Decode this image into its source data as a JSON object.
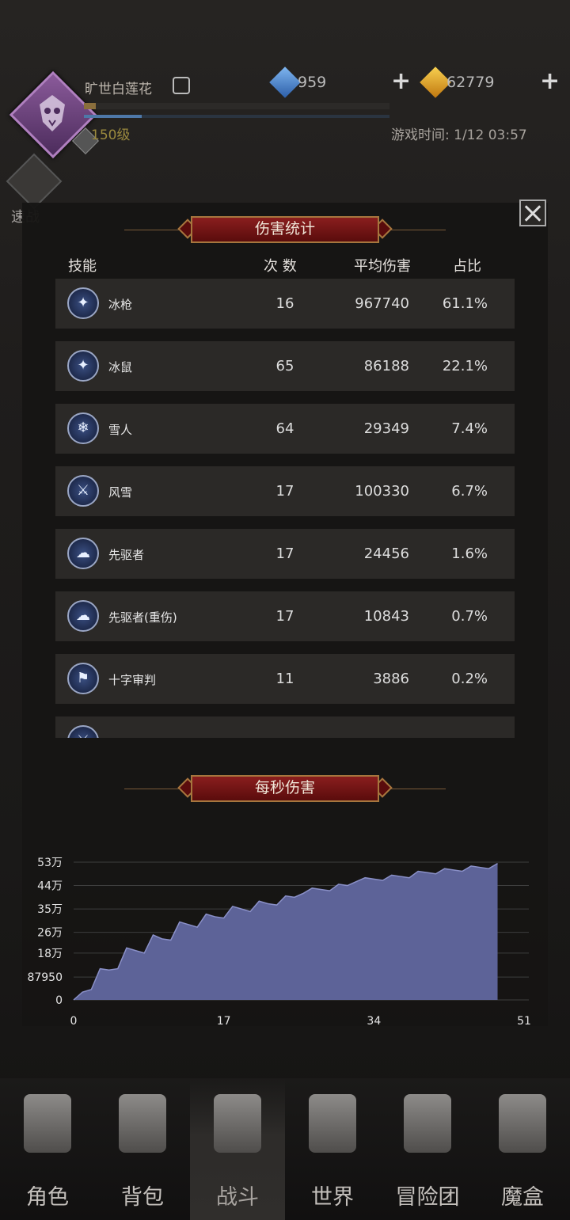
{
  "header": {
    "player_name": "旷世白莲花",
    "level": "150级",
    "exp_fraction": 0.04,
    "energy_fraction": 0.19,
    "currency_gems": "959",
    "currency_gold": "62779",
    "game_time": "游戏时间: 1/12 03:57",
    "quick_battle": "速战"
  },
  "modal": {
    "title": "伤害统计",
    "columns": {
      "skill": "技能",
      "count": "次 数",
      "avg": "平均伤害",
      "ratio": "占比"
    },
    "rows": [
      {
        "icon": "ice-spear-icon",
        "glyph": "✦",
        "name": "冰枪",
        "count": "16",
        "avg": "967740",
        "pct": "61.1%"
      },
      {
        "icon": "ice-rat-icon",
        "glyph": "✦",
        "name": "冰鼠",
        "count": "65",
        "avg": "86188",
        "pct": "22.1%"
      },
      {
        "icon": "snowflake-icon",
        "glyph": "❄",
        "name": "雪人",
        "count": "64",
        "avg": "29349",
        "pct": "7.4%"
      },
      {
        "icon": "sword-icon",
        "glyph": "⚔",
        "name": "风雪",
        "count": "17",
        "avg": "100330",
        "pct": "6.7%"
      },
      {
        "icon": "mushroom-cloud-icon",
        "glyph": "☁",
        "name": "先驱者",
        "count": "17",
        "avg": "24456",
        "pct": "1.6%"
      },
      {
        "icon": "mushroom-cloud-icon",
        "glyph": "☁",
        "name": "先驱者(重伤)",
        "count": "17",
        "avg": "10843",
        "pct": "0.7%"
      },
      {
        "icon": "banner-icon",
        "glyph": "⚑",
        "name": "十字审判",
        "count": "11",
        "avg": "3886",
        "pct": "0.2%"
      },
      {
        "icon": "sword-icon",
        "glyph": "⚔",
        "name": "",
        "count": "",
        "avg": "",
        "pct": ""
      }
    ],
    "dps_title": "每秒伤害"
  },
  "chart_data": {
    "type": "area",
    "title": "每秒伤害",
    "xlabel": "",
    "ylabel": "",
    "xlim": [
      0,
      51
    ],
    "ylim": [
      0,
      530000
    ],
    "x_ticks": [
      "0",
      "17",
      "34",
      "51"
    ],
    "y_ticks": [
      "0",
      "87950",
      "18万",
      "26万",
      "35万",
      "44万",
      "53万"
    ],
    "y_tick_values": [
      0,
      87950,
      180000,
      260000,
      350000,
      440000,
      530000
    ],
    "x": [
      0,
      1,
      2,
      3,
      4,
      5,
      6,
      7,
      8,
      9,
      10,
      11,
      12,
      13,
      14,
      15,
      16,
      17,
      18,
      19,
      20,
      21,
      22,
      23,
      24,
      25,
      26,
      27,
      28,
      29,
      30,
      31,
      32,
      33,
      34,
      35,
      36,
      37,
      38,
      39,
      40,
      41,
      42,
      43,
      44,
      45,
      46,
      47,
      48
    ],
    "values": [
      0,
      30000,
      40000,
      120000,
      115000,
      120000,
      200000,
      190000,
      180000,
      250000,
      235000,
      230000,
      300000,
      290000,
      280000,
      330000,
      320000,
      315000,
      360000,
      350000,
      340000,
      380000,
      370000,
      365000,
      400000,
      395000,
      410000,
      430000,
      425000,
      420000,
      445000,
      440000,
      455000,
      470000,
      465000,
      460000,
      480000,
      475000,
      470000,
      495000,
      490000,
      485000,
      505000,
      500000,
      495000,
      515000,
      510000,
      505000,
      525000
    ],
    "fill_color": "#5d6398",
    "line_color": "#8a90c8",
    "grid": true
  },
  "nav": {
    "items": [
      {
        "label": "角色",
        "icon": "helmet-icon",
        "active": false
      },
      {
        "label": "背包",
        "icon": "backpack-icon",
        "active": false
      },
      {
        "label": "战斗",
        "icon": "crossed-swords-icon",
        "active": true
      },
      {
        "label": "世界",
        "icon": "map-scroll-icon",
        "active": false
      },
      {
        "label": "冒险团",
        "icon": "castle-icon",
        "active": false
      },
      {
        "label": "魔盒",
        "icon": "magic-box-icon",
        "active": false
      }
    ]
  }
}
